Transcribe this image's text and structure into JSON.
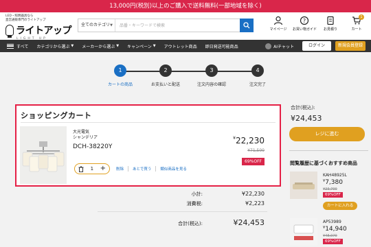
{
  "promo": {
    "text": "13,000円(税別)以上のご購入で送料無料(一部地域を除く)"
  },
  "header": {
    "logo_tag_1": "LED・照明器具なら",
    "logo_tag_2": "直営通販専門のライトアップ",
    "logo_text": "ライトアップ",
    "logo_sub": "LIGHT UP",
    "search_category": "全てのカテゴリ",
    "search_placeholder": "品番・キーワードで検索",
    "icons": [
      {
        "name": "mypage",
        "label": "マイページ"
      },
      {
        "name": "shopping-guide",
        "label": "お買い物ガイド"
      },
      {
        "name": "inquiry",
        "label": "お見積り"
      },
      {
        "name": "cart",
        "label": "カート",
        "count": "1"
      }
    ]
  },
  "nav": {
    "items": [
      "すべて",
      "カテゴリから選ぶ",
      "メーカーから選ぶ",
      "キャンペーン",
      "アウトレット商品",
      "即日発送可能商品"
    ],
    "ai_chat": "AIチャット",
    "login": "ログイン",
    "register": "新規会員登録"
  },
  "steps": [
    {
      "num": "1",
      "label": "カートの商品"
    },
    {
      "num": "2",
      "label": "お支払いと配送"
    },
    {
      "num": "3",
      "label": "注文内容の確認"
    },
    {
      "num": "4",
      "label": "注文完了"
    }
  ],
  "cart": {
    "title": "ショッピングカート",
    "item": {
      "maker": "大光電気",
      "series": "シャンデリア",
      "code": "DCH-38220Y",
      "qty": "1",
      "actions": [
        "削除",
        "あとで買う",
        "類似商品を見る"
      ],
      "price_yen": "¥",
      "price": "22,230",
      "old_price": "¥71,500",
      "discount": "69%OFF"
    }
  },
  "summary": {
    "subtotal_label": "小計:",
    "subtotal": "¥22,230",
    "tax_label": "消費税:",
    "tax": "¥2,223",
    "total_label": "合計(税込):",
    "total": "¥24,453"
  },
  "sidebar": {
    "total_label": "合計(税込):",
    "total": "¥24,453",
    "checkout": "レジに進む",
    "reco_title": "閲覧履歴に基づくおすすめ商品",
    "items": [
      {
        "code": "KAH48925L",
        "yen": "¥",
        "price": "7,380",
        "old": "¥23,700",
        "discount": "69%OFF",
        "cart_label": "カートに入れる"
      },
      {
        "code": "AP53989",
        "yen": "¥",
        "price": "14,940",
        "old": "¥48,070",
        "discount": "69%OFF"
      }
    ]
  },
  "colors": {
    "promo": "#d9264a",
    "accent_blue": "#1a6fc4",
    "accent_gold": "#e0a020",
    "highlight_border": "#e51f45"
  }
}
